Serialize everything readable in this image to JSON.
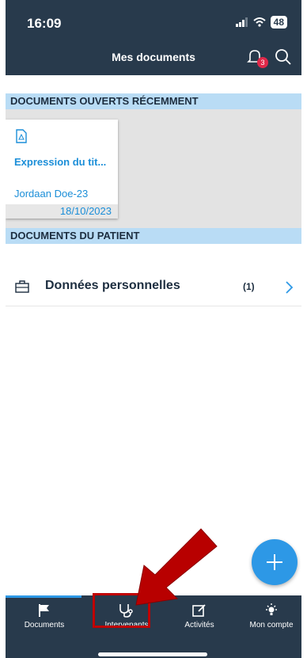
{
  "status_bar": {
    "time": "16:09",
    "battery": "48"
  },
  "header": {
    "title": "Mes documents",
    "notification_count": "3"
  },
  "recent": {
    "section_title": "DOCUMENTS OUVERTS RÉCEMMENT",
    "card": {
      "name": "Expression du tit...",
      "patient": "Jordaan Doe-23",
      "date": "18/10/2023"
    }
  },
  "patient_docs": {
    "section_title": "DOCUMENTS DU PATIENT",
    "items": [
      {
        "label": "Données personnelles",
        "count": "(1)"
      }
    ]
  },
  "tabs": [
    {
      "label": "Documents"
    },
    {
      "label": "Intervenants"
    },
    {
      "label": "Activités"
    },
    {
      "label": "Mon compte"
    }
  ],
  "colors": {
    "header_bg": "#283a4c",
    "accent": "#2d98e6",
    "section_bg": "#b9dcf5",
    "annotation": "#c00000"
  }
}
